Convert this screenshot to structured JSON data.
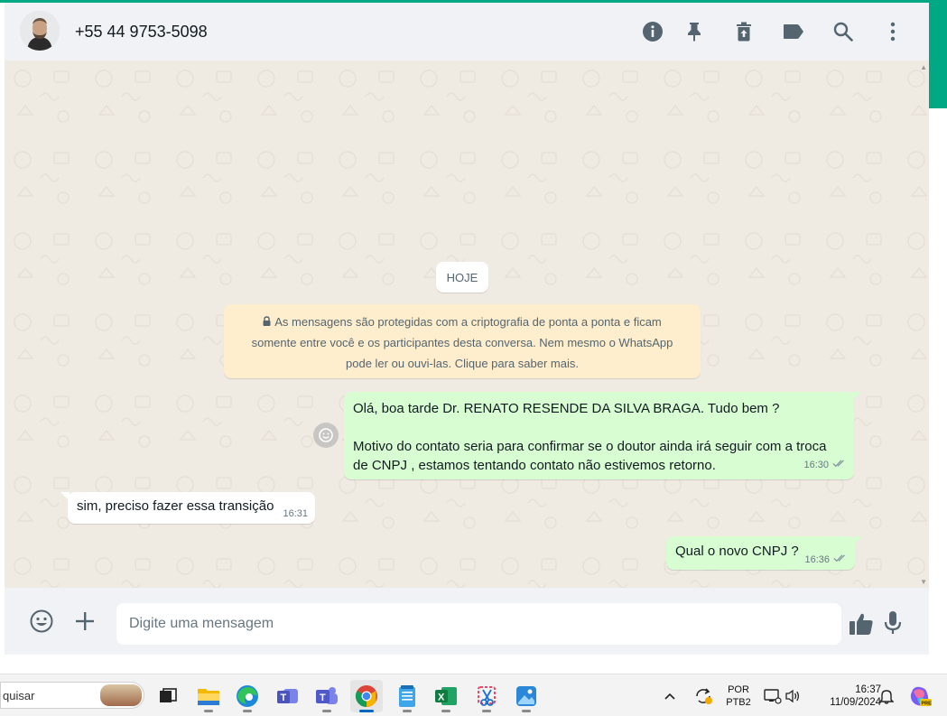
{
  "window": {
    "accent_color": "#00a884"
  },
  "header": {
    "contact_name": "+55 44 9753-5098",
    "icons": [
      "info-icon",
      "pin-icon",
      "delete-icon",
      "label-icon",
      "search-icon",
      "menu-icon"
    ]
  },
  "chat": {
    "date_chip": "HOJE",
    "encryption_notice": {
      "line1": "As mensagens são protegidas com a criptografia de ponta a ponta e ficam",
      "line2": "somente entre você e os participantes desta conversa. Nem mesmo o WhatsApp",
      "line3": "pode ler ou ouvi-las. Clique para saber mais."
    },
    "messages": [
      {
        "direction": "out",
        "line1": "Olá, boa tarde Dr.  RENATO RESENDE DA SILVA BRAGA. Tudo bem ?",
        "line2": "Motivo do contato seria para confirmar se o doutor ainda irá seguir com a troca",
        "line3": "de CNPJ , estamos tentando contato não estivemos retorno.",
        "time": "16:30",
        "status": "read"
      },
      {
        "direction": "in",
        "text": "sim, preciso fazer essa transição",
        "time": "16:31"
      },
      {
        "direction": "out",
        "text": "Qual o novo CNPJ ?",
        "time": "16:36",
        "status": "read"
      }
    ],
    "bubble_out_color": "#d9fdd3",
    "bubble_in_color": "#ffffff",
    "background_color": "#efeae2"
  },
  "composer": {
    "placeholder": "Digite uma mensagem",
    "value": ""
  },
  "taskbar": {
    "search_text": "quisar",
    "apps": [
      "file-explorer",
      "edge",
      "teams-classic",
      "teams",
      "chrome",
      "notepad",
      "excel",
      "snipping-tool",
      "photos"
    ],
    "active_app": "chrome",
    "language_line1": "POR",
    "language_line2": "PTB2",
    "time": "16:37",
    "date": "11/09/2024"
  }
}
